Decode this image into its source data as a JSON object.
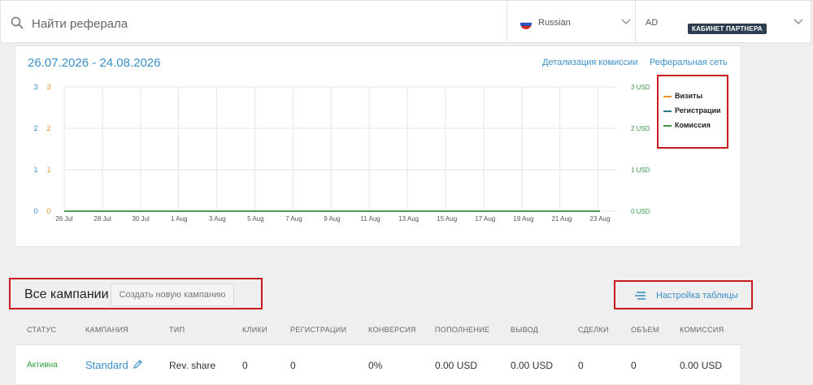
{
  "header": {
    "search_placeholder": "Найти реферала",
    "language": "Russian",
    "account_initials": "AD",
    "account_badge": "КАБИНЕТ ПАРТНЕРА"
  },
  "chart_section": {
    "date_range": "26.07.2026 - 24.08.2026",
    "links": [
      "Детализация комиссии",
      "Реферальная сеть"
    ]
  },
  "chart_data": {
    "type": "line",
    "x": [
      "26 Jul",
      "28 Jul",
      "30 Jul",
      "1 Aug",
      "3 Aug",
      "5 Aug",
      "7 Aug",
      "9 Aug",
      "11 Aug",
      "13 Aug",
      "15 Aug",
      "17 Aug",
      "19 Aug",
      "21 Aug",
      "23 Aug"
    ],
    "left_axis_ticks": [
      "0",
      "1",
      "2",
      "3"
    ],
    "left_axis2_ticks": [
      "0",
      "1",
      "2",
      "3"
    ],
    "right_axis_ticks": [
      "0 USD",
      "1 USD",
      "2 USD",
      "3 USD"
    ],
    "ylim": [
      0,
      3
    ],
    "grid": true,
    "legend_position": "right",
    "series": [
      {
        "name": "Визиты",
        "color": "#f0932b",
        "values": [
          0,
          0,
          0,
          0,
          0,
          0,
          0,
          0,
          0,
          0,
          0,
          0,
          0,
          0,
          0
        ]
      },
      {
        "name": "Регистрации",
        "color": "#2d7a8a",
        "values": [
          0,
          0,
          0,
          0,
          0,
          0,
          0,
          0,
          0,
          0,
          0,
          0,
          0,
          0,
          0
        ]
      },
      {
        "name": "Комиссия",
        "color": "#3c9a4a",
        "values": [
          0,
          0,
          0,
          0,
          0,
          0,
          0,
          0,
          0,
          0,
          0,
          0,
          0,
          0,
          0
        ]
      }
    ]
  },
  "campaigns": {
    "title": "Все кампании",
    "create_button": "Создать новую кампанию",
    "table_settings": "Настройка таблицы",
    "columns": [
      "Статус",
      "Кампания",
      "Тип",
      "Клики",
      "Регистрации",
      "Конверсия",
      "Пополнение",
      "Вывод",
      "Сделки",
      "Объем",
      "Комиссия"
    ],
    "rows": [
      {
        "status": "Активна",
        "campaign": "Standard",
        "type": "Rev. share",
        "clicks": "0",
        "registrations": "0",
        "conversion": "0%",
        "deposit": "0.00 USD",
        "withdrawal": "0.00 USD",
        "deals": "0",
        "volume": "0",
        "commission": "0.00 USD"
      }
    ]
  },
  "colors": {
    "accent": "#3a90c8",
    "status_active": "#2e9e3a",
    "highlight_border": "#c8191e",
    "badge_bg": "#2d3e50"
  }
}
